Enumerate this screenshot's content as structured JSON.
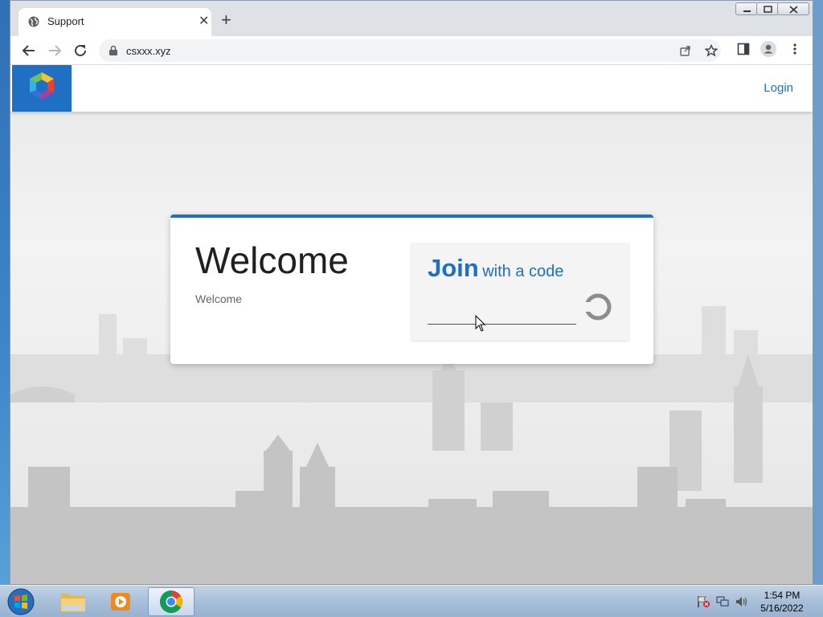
{
  "browser": {
    "tab_title": "Support",
    "url": "csxxx.xyz"
  },
  "site": {
    "login_label": "Login"
  },
  "card": {
    "title": "Welcome",
    "subtitle": "Welcome",
    "join_word": "Join",
    "join_rest": "with a code",
    "code_value": ""
  },
  "taskbar": {
    "time": "1:54 PM",
    "date": "5/16/2022",
    "apps": [
      "file-explorer",
      "media-player",
      "chrome"
    ]
  },
  "colors": {
    "accent": "#1f6fc2",
    "card_border": "#1f6fc2"
  }
}
